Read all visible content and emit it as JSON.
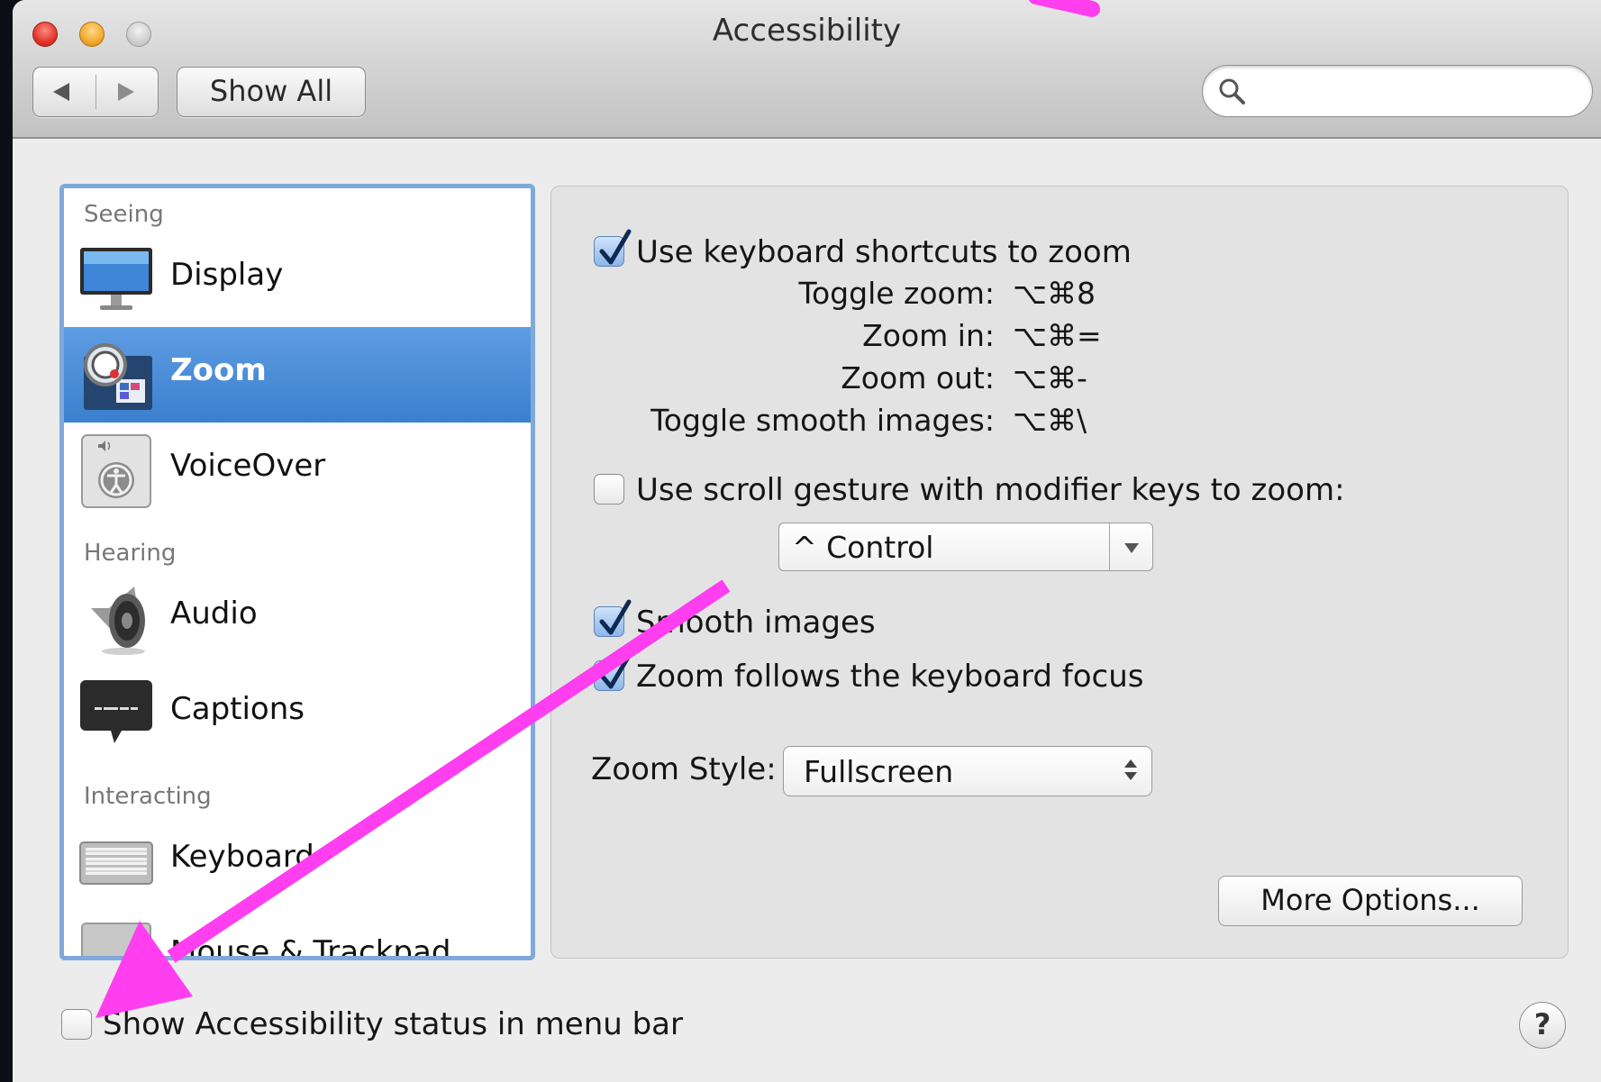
{
  "window": {
    "title": "Accessibility",
    "show_all_label": "Show All",
    "search": {
      "placeholder": "",
      "value": ""
    }
  },
  "sidebar": {
    "sections": [
      {
        "label": "Seeing",
        "items": [
          {
            "label": "Display",
            "icon": "display-icon"
          },
          {
            "label": "Zoom",
            "icon": "zoom-icon",
            "selected": true
          },
          {
            "label": "VoiceOver",
            "icon": "voiceover-icon"
          }
        ]
      },
      {
        "label": "Hearing",
        "items": [
          {
            "label": "Audio",
            "icon": "speaker-icon"
          },
          {
            "label": "Captions",
            "icon": "captions-icon"
          }
        ]
      },
      {
        "label": "Interacting",
        "items": [
          {
            "label": "Keyboard",
            "icon": "keyboard-icon"
          },
          {
            "label": "Mouse & Trackpad",
            "icon": "trackpad-icon"
          }
        ]
      }
    ]
  },
  "zoom": {
    "keyboard_shortcuts": {
      "label": "Use keyboard shortcuts to zoom",
      "checked": true,
      "shortcuts": [
        {
          "name": "Toggle zoom:",
          "keys": "⌥⌘8"
        },
        {
          "name": "Zoom in:",
          "keys": "⌥⌘="
        },
        {
          "name": "Zoom out:",
          "keys": "⌥⌘-"
        },
        {
          "name": "Toggle smooth images:",
          "keys": "⌥⌘\\"
        }
      ]
    },
    "scroll_gesture": {
      "label": "Use scroll gesture with modifier keys to zoom:",
      "checked": false,
      "modifier": "^ Control"
    },
    "smooth_images": {
      "label": "Smooth images",
      "checked": true
    },
    "follow_focus": {
      "label": "Zoom follows the keyboard focus",
      "checked": true
    },
    "zoom_style": {
      "label": "Zoom Style:",
      "value": "Fullscreen"
    },
    "more_options_label": "More Options..."
  },
  "footer": {
    "show_status": {
      "label": "Show Accessibility status in menu bar",
      "checked": false
    },
    "help_label": "?"
  },
  "colors": {
    "selection": "#3a7fce",
    "annotation_arrow": "#ff3ef0"
  }
}
